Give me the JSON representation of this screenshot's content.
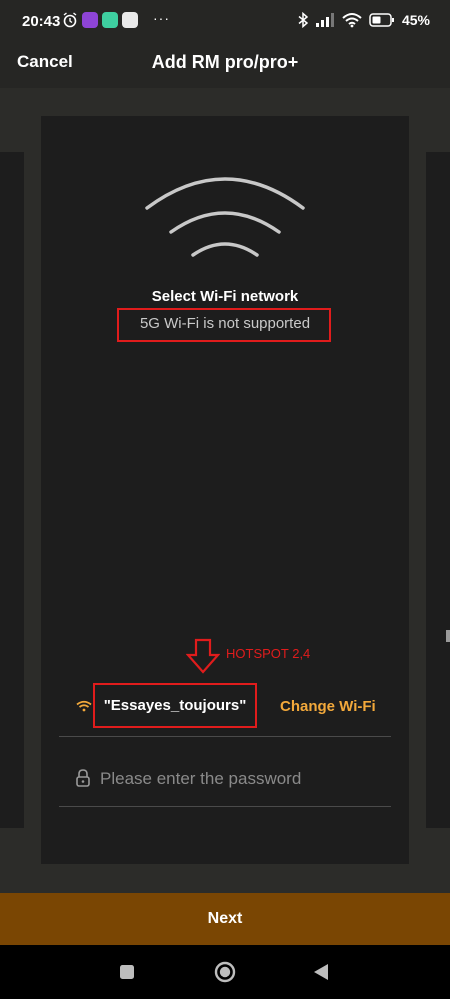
{
  "status_bar": {
    "time": "20:43",
    "dots": "···",
    "battery": "45%"
  },
  "header": {
    "cancel_label": "Cancel",
    "title": "Add RM pro/pro+"
  },
  "setup": {
    "select_title": "Select Wi-Fi network",
    "note": "5G Wi-Fi is not supported"
  },
  "annotation": {
    "hotspot_text": "HOTSPOT 2,4",
    "color": "#e01c1c"
  },
  "wifi": {
    "ssid": "\"Essayes_toujours\"",
    "change_label": "Change Wi-Fi",
    "accent_color": "#f3a93b"
  },
  "password": {
    "placeholder": "Please enter the password",
    "value": ""
  },
  "footer": {
    "next_label": "Next",
    "button_color": "#7a4603"
  },
  "icons": [
    "alarm-icon",
    "app-icon",
    "bluetooth-icon",
    "signal-icon",
    "wifi-icon",
    "battery-icon",
    "lock-icon",
    "wifi-large-icon",
    "wifi-small-icon",
    "square-nav-icon",
    "circle-nav-icon",
    "back-nav-icon"
  ]
}
